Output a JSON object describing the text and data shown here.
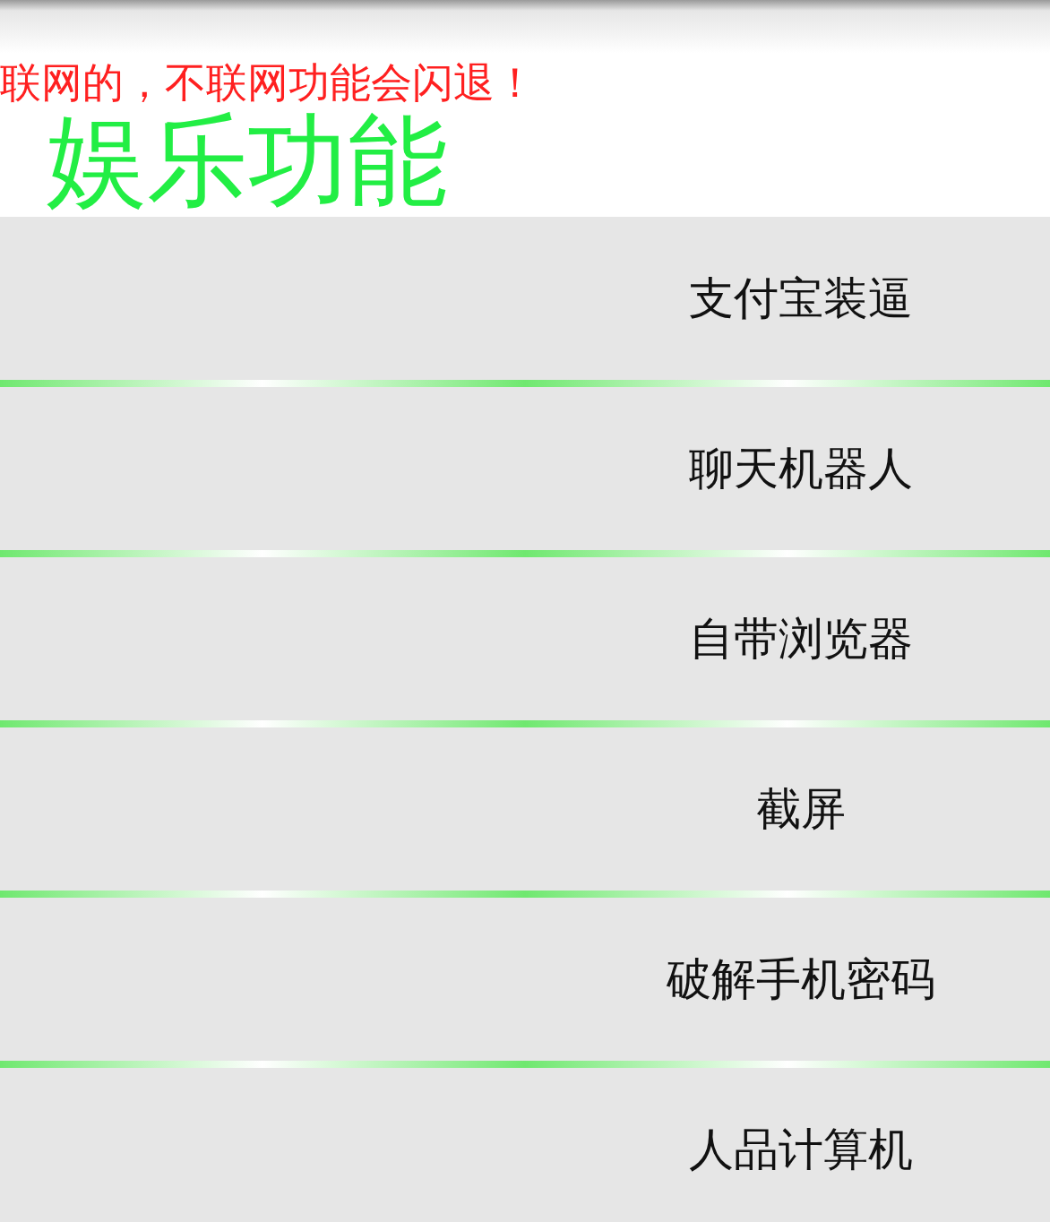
{
  "warning": "联网的，不联网功能会闪退！",
  "title": "娱乐功能",
  "menu": [
    {
      "label": "支付宝装逼"
    },
    {
      "label": "聊天机器人"
    },
    {
      "label": "自带浏览器"
    },
    {
      "label": "截屏"
    },
    {
      "label": "破解手机密码"
    },
    {
      "label": "人品计算机"
    }
  ]
}
